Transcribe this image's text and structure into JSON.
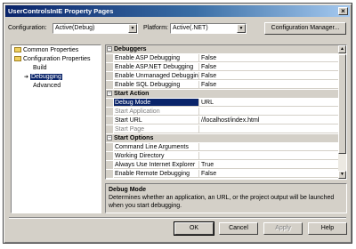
{
  "window": {
    "title": "UserControlsInIE Property Pages",
    "close_symbol": "×"
  },
  "toolbar": {
    "configuration_label": "Configuration:",
    "configuration_value": "Active(Debug)",
    "platform_label": "Platform:",
    "platform_value": "Active(.NET)",
    "config_manager_label": "Configuration Manager..."
  },
  "tree": {
    "common": "Common Properties",
    "config": "Configuration Properties",
    "build": "Build",
    "debugging": "Debugging",
    "advanced": "Advanced"
  },
  "grid": {
    "rows": [
      {
        "cat": "Debuggers"
      },
      {
        "name": "Enable ASP Debugging",
        "value": "False"
      },
      {
        "name": "Enable ASP.NET Debugging",
        "value": "False"
      },
      {
        "name": "Enable Unmanaged Debugging",
        "value": "False"
      },
      {
        "name": "Enable SQL Debugging",
        "value": "False"
      },
      {
        "cat": "Start Action"
      },
      {
        "name": "Debug Mode",
        "value": "URL",
        "selected": true
      },
      {
        "name": "Start Application",
        "value": "",
        "disabled": true
      },
      {
        "name": "Start URL",
        "value": "//localhost/index.html"
      },
      {
        "name": "Start Page",
        "value": "",
        "disabled": true
      },
      {
        "cat": "Start Options"
      },
      {
        "name": "Command Line Arguments",
        "value": ""
      },
      {
        "name": "Working Directory",
        "value": ""
      },
      {
        "name": "Always Use Internet Explorer",
        "value": "True"
      },
      {
        "name": "Enable Remote Debugging",
        "value": "False"
      }
    ]
  },
  "description": {
    "title": "Debug Mode",
    "text": "Determines whether an application, an URL, or the project output will be launched when you start debugging."
  },
  "buttons": {
    "ok": "OK",
    "cancel": "Cancel",
    "apply": "Apply",
    "help": "Help"
  }
}
